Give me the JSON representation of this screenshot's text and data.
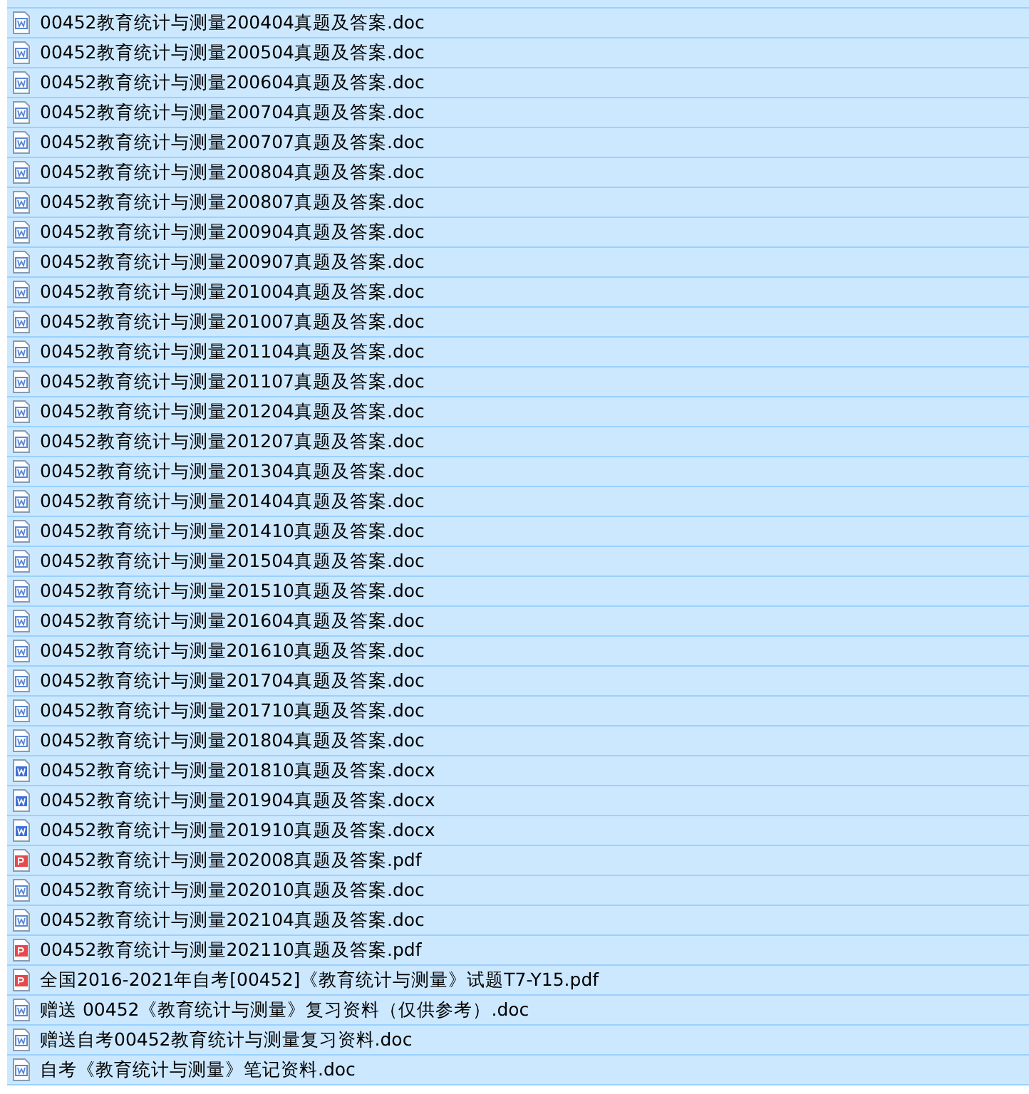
{
  "files": [
    {
      "name": "00452教育统计与测量200404真题及答案.doc",
      "kind": "doc",
      "selected": true
    },
    {
      "name": "00452教育统计与测量200504真题及答案.doc",
      "kind": "doc",
      "selected": true
    },
    {
      "name": "00452教育统计与测量200604真题及答案.doc",
      "kind": "doc",
      "selected": true
    },
    {
      "name": "00452教育统计与测量200704真题及答案.doc",
      "kind": "doc",
      "selected": true
    },
    {
      "name": "00452教育统计与测量200707真题及答案.doc",
      "kind": "doc",
      "selected": true
    },
    {
      "name": "00452教育统计与测量200804真题及答案.doc",
      "kind": "doc",
      "selected": true
    },
    {
      "name": "00452教育统计与测量200807真题及答案.doc",
      "kind": "doc",
      "selected": true
    },
    {
      "name": "00452教育统计与测量200904真题及答案.doc",
      "kind": "doc",
      "selected": true
    },
    {
      "name": "00452教育统计与测量200907真题及答案.doc",
      "kind": "doc",
      "selected": true
    },
    {
      "name": "00452教育统计与测量201004真题及答案.doc",
      "kind": "doc",
      "selected": true
    },
    {
      "name": "00452教育统计与测量201007真题及答案.doc",
      "kind": "doc",
      "selected": true
    },
    {
      "name": "00452教育统计与测量201104真题及答案.doc",
      "kind": "doc",
      "selected": true
    },
    {
      "name": "00452教育统计与测量201107真题及答案.doc",
      "kind": "doc",
      "selected": true
    },
    {
      "name": "00452教育统计与测量201204真题及答案.doc",
      "kind": "doc",
      "selected": true
    },
    {
      "name": "00452教育统计与测量201207真题及答案.doc",
      "kind": "doc",
      "selected": true
    },
    {
      "name": "00452教育统计与测量201304真题及答案.doc",
      "kind": "doc",
      "selected": true
    },
    {
      "name": "00452教育统计与测量201404真题及答案.doc",
      "kind": "doc",
      "selected": true
    },
    {
      "name": "00452教育统计与测量201410真题及答案.doc",
      "kind": "doc",
      "selected": true
    },
    {
      "name": "00452教育统计与测量201504真题及答案.doc",
      "kind": "doc",
      "selected": true
    },
    {
      "name": "00452教育统计与测量201510真题及答案.doc",
      "kind": "doc",
      "selected": true
    },
    {
      "name": "00452教育统计与测量201604真题及答案.doc",
      "kind": "doc",
      "selected": true
    },
    {
      "name": "00452教育统计与测量201610真题及答案.doc",
      "kind": "doc",
      "selected": true
    },
    {
      "name": "00452教育统计与测量201704真题及答案.doc",
      "kind": "doc",
      "selected": true
    },
    {
      "name": "00452教育统计与测量201710真题及答案.doc",
      "kind": "doc",
      "selected": true
    },
    {
      "name": "00452教育统计与测量201804真题及答案.doc",
      "kind": "doc",
      "selected": true
    },
    {
      "name": "00452教育统计与测量201810真题及答案.docx",
      "kind": "docx",
      "selected": true
    },
    {
      "name": "00452教育统计与测量201904真题及答案.docx",
      "kind": "docx",
      "selected": true
    },
    {
      "name": "00452教育统计与测量201910真题及答案.docx",
      "kind": "docx",
      "selected": true
    },
    {
      "name": "00452教育统计与测量202008真题及答案.pdf",
      "kind": "pdf",
      "selected": true
    },
    {
      "name": "00452教育统计与测量202010真题及答案.doc",
      "kind": "doc",
      "selected": true
    },
    {
      "name": "00452教育统计与测量202104真题及答案.doc",
      "kind": "doc",
      "selected": true
    },
    {
      "name": "00452教育统计与测量202110真题及答案.pdf",
      "kind": "pdf",
      "selected": true
    },
    {
      "name": "全国2016-2021年自考[00452]《教育统计与测量》试题T7-Y15.pdf",
      "kind": "pdf",
      "selected": true
    },
    {
      "name": "赠送 00452《教育统计与测量》复习资料（仅供参考）.doc",
      "kind": "doc",
      "selected": true
    },
    {
      "name": "赠送自考00452教育统计与测量复习资料.doc",
      "kind": "doc",
      "selected": true
    },
    {
      "name": "自考《教育统计与测量》笔记资料.doc",
      "kind": "doc",
      "selected": true
    }
  ]
}
